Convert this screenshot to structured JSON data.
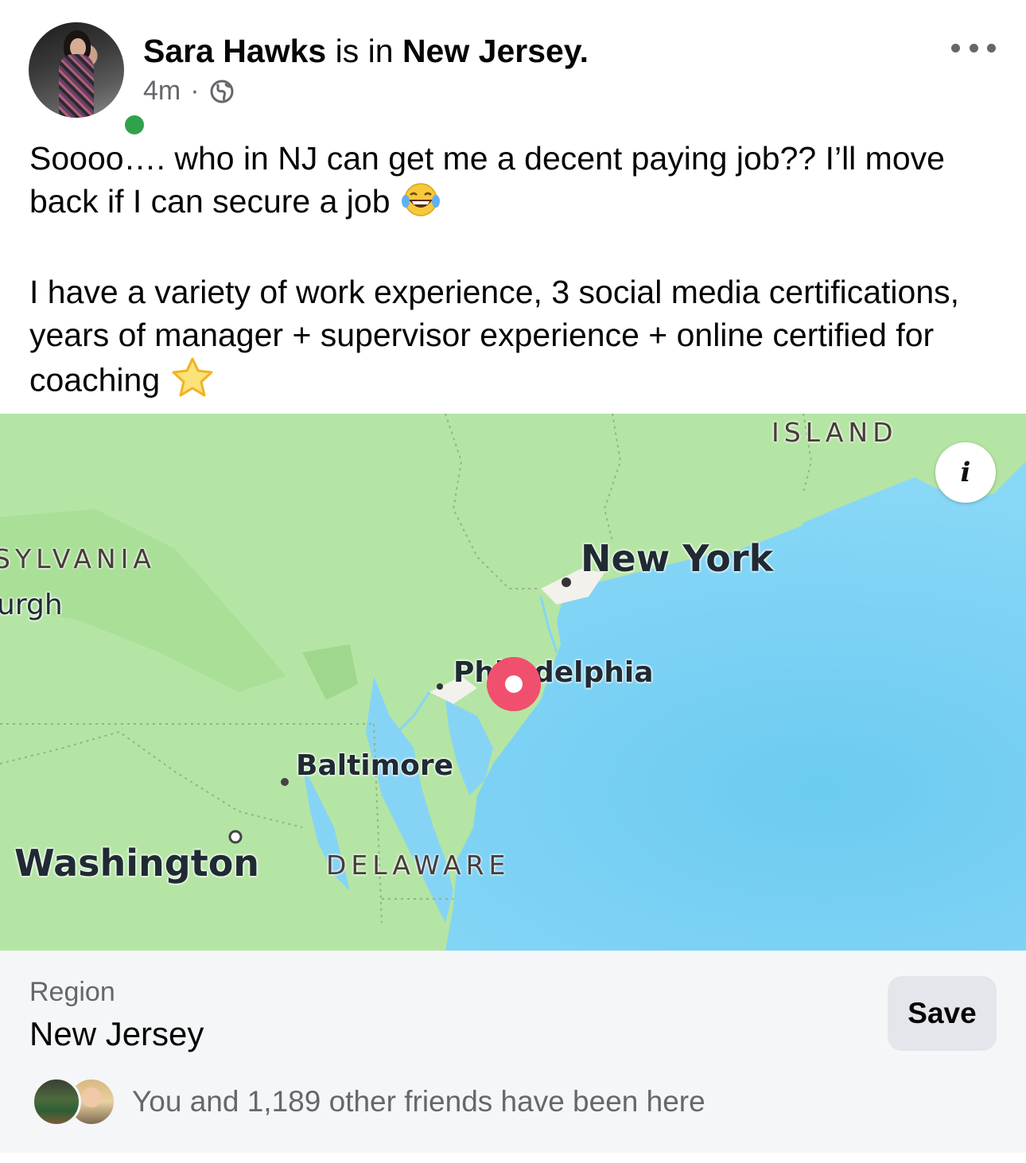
{
  "post": {
    "author": "Sara Hawks",
    "is_in": "is in",
    "location": "New Jersey.",
    "time": "4m",
    "separator": "·",
    "privacy_icon": "globe-icon",
    "more_icon": "more-horizontal-icon",
    "text_line1": "Soooo…. who in NJ can get me a decent paying job?? I’ll move back if I can secure a job",
    "emoji1": "😂",
    "text_line2": "I have a variety of work experience, 3 social media certifications, years of manager + supervisor experience + online certified for coaching",
    "emoji2": "⭐"
  },
  "map": {
    "labels": {
      "island": "ISLAND",
      "sylvania": "SYLVANIA",
      "urgh": "urgh",
      "new_york": "New York",
      "philadelphia": "Philadelphia",
      "baltimore": "Baltimore",
      "washington": "Washington",
      "delaware": "DELAWARE"
    },
    "info_icon": "i",
    "pin_color": "#f0506e",
    "water_color": "#86d4f5",
    "land_color": "#b5e5a4"
  },
  "place": {
    "region_label": "Region",
    "region_value": "New Jersey",
    "save_label": "Save",
    "friends_text": "You and 1,189 other friends have been here"
  }
}
